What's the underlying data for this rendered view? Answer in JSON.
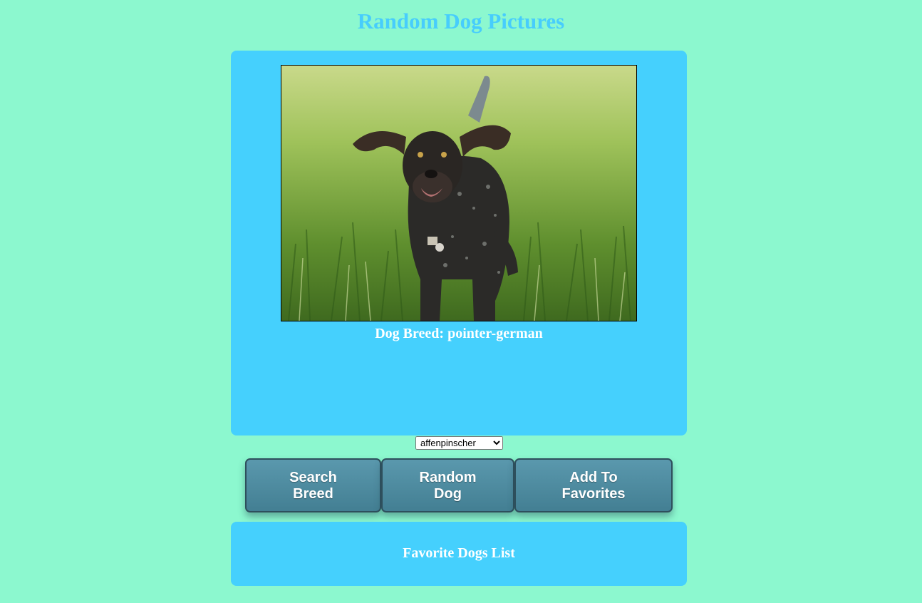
{
  "page": {
    "title": "Random Dog Pictures"
  },
  "dog_card": {
    "breed_caption": "Dog Breed: pointer-german",
    "photo_alt": "pointer-german"
  },
  "breed_select": {
    "selected": "affenpinscher",
    "options": [
      "affenpinscher"
    ]
  },
  "buttons": {
    "search_line1": "Search",
    "search_line2": "Breed",
    "random_line1": "Random",
    "random_line2": "Dog",
    "favorites_line1": "Add To",
    "favorites_line2": "Favorites"
  },
  "favorites": {
    "title": "Favorite Dogs List"
  },
  "colors": {
    "background": "#8cf8cf",
    "card": "#45d0fd",
    "title": "#47cdfc",
    "button": "#4f8ea3",
    "button_text": "#ffffff"
  }
}
